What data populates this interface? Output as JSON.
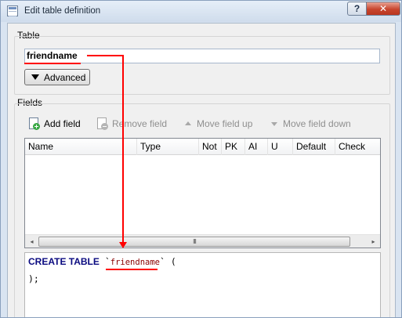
{
  "window": {
    "title": "Edit table definition",
    "help_button": "?",
    "close_button": "✕"
  },
  "table_section": {
    "label": "Table",
    "name_value": "friendname",
    "advanced_button": "Advanced"
  },
  "fields_section": {
    "label": "Fields",
    "toolbar": {
      "add_field": "Add field",
      "remove_field": "Remove field",
      "move_up": "Move field up",
      "move_down": "Move field down"
    },
    "columns": [
      "Name",
      "Type",
      "Not",
      "PK",
      "AI",
      "U",
      "Default",
      "Check"
    ],
    "rows": [],
    "scrollbar": {
      "left_arrow": "◂",
      "right_arrow": "▸",
      "thumb_grip": "III"
    }
  },
  "sql_preview": {
    "keyword": "CREATE TABLE",
    "open_quote": "`",
    "table_name": "friendname",
    "close_quote_paren": "` (",
    "closing": ");"
  },
  "colors": {
    "annotation": "#ff0000",
    "sql_keyword": "#0a0a80",
    "sql_identifier": "#8b0000"
  }
}
